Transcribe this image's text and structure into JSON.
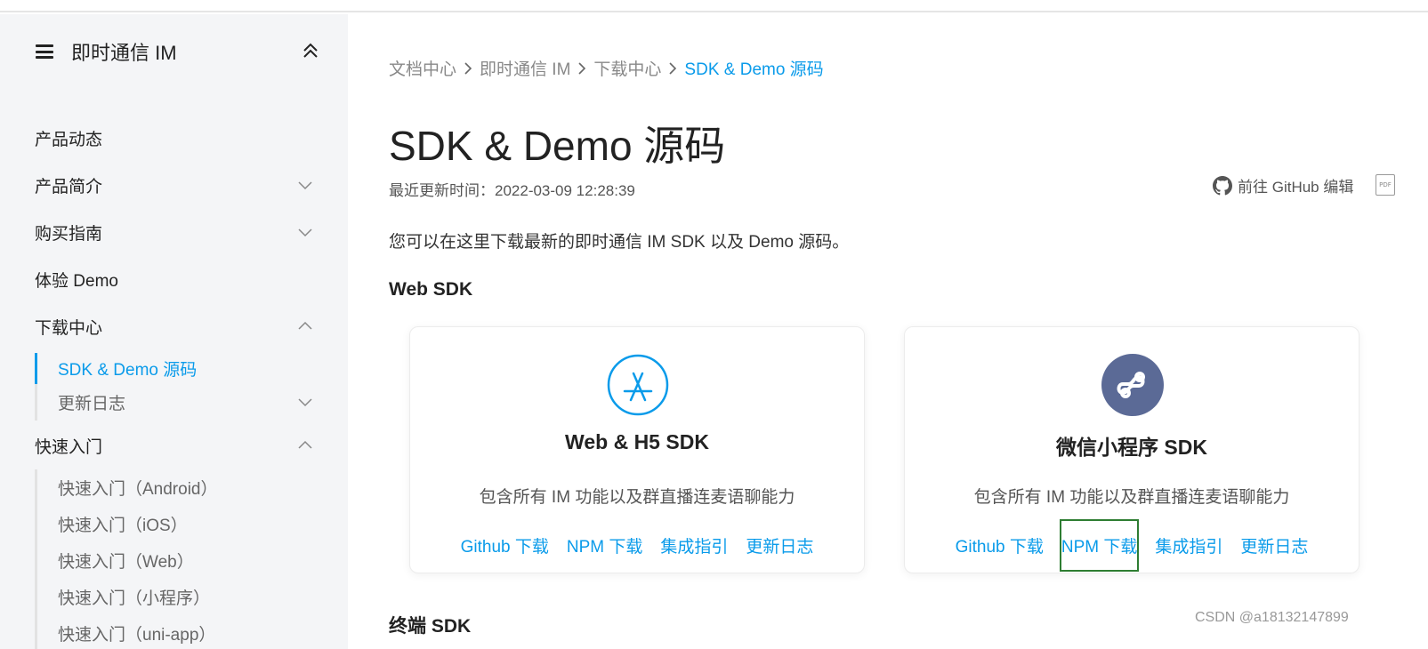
{
  "sidebar": {
    "title": "即时通信 IM",
    "items": [
      {
        "label": "产品动态"
      },
      {
        "label": "产品简介"
      },
      {
        "label": "购买指南"
      },
      {
        "label": "体验 Demo"
      },
      {
        "label": "下载中心"
      },
      {
        "label": "快速入门"
      }
    ],
    "download_sub": [
      {
        "label": "SDK & Demo 源码"
      },
      {
        "label": "更新日志"
      }
    ],
    "quickstart_sub": [
      {
        "label": "快速入门（Android）"
      },
      {
        "label": "快速入门（iOS）"
      },
      {
        "label": "快速入门（Web）"
      },
      {
        "label": "快速入门（小程序）"
      },
      {
        "label": "快速入门（uni-app）"
      }
    ]
  },
  "breadcrumb": [
    "文档中心",
    "即时通信 IM",
    "下载中心",
    "SDK & Demo 源码"
  ],
  "page": {
    "title": "SDK & Demo 源码",
    "update_time": "最近更新时间：2022-03-09 12:28:39",
    "github_edit": "前往 GitHub 编辑",
    "pdf_label": "PDF",
    "intro": "您可以在这里下载最新的即时通信 IM SDK 以及 Demo 源码。",
    "section_web": "Web SDK",
    "section_terminal": "终端 SDK"
  },
  "cards": [
    {
      "title": "Web & H5 SDK",
      "desc": "包含所有 IM 功能以及群直播连麦语聊能力",
      "links": [
        "Github 下载",
        "NPM 下载",
        "集成指引",
        "更新日志"
      ]
    },
    {
      "title": "微信小程序 SDK",
      "desc": "包含所有 IM 功能以及群直播连麦语聊能力",
      "links": [
        "Github 下载",
        "NPM 下载",
        "集成指引",
        "更新日志"
      ]
    }
  ],
  "watermark": "CSDN @a18132147899",
  "colors": {
    "accent": "#0a9bea",
    "highlight_box": "#2e7d32",
    "miniprogram_icon": "#5b6a96"
  }
}
